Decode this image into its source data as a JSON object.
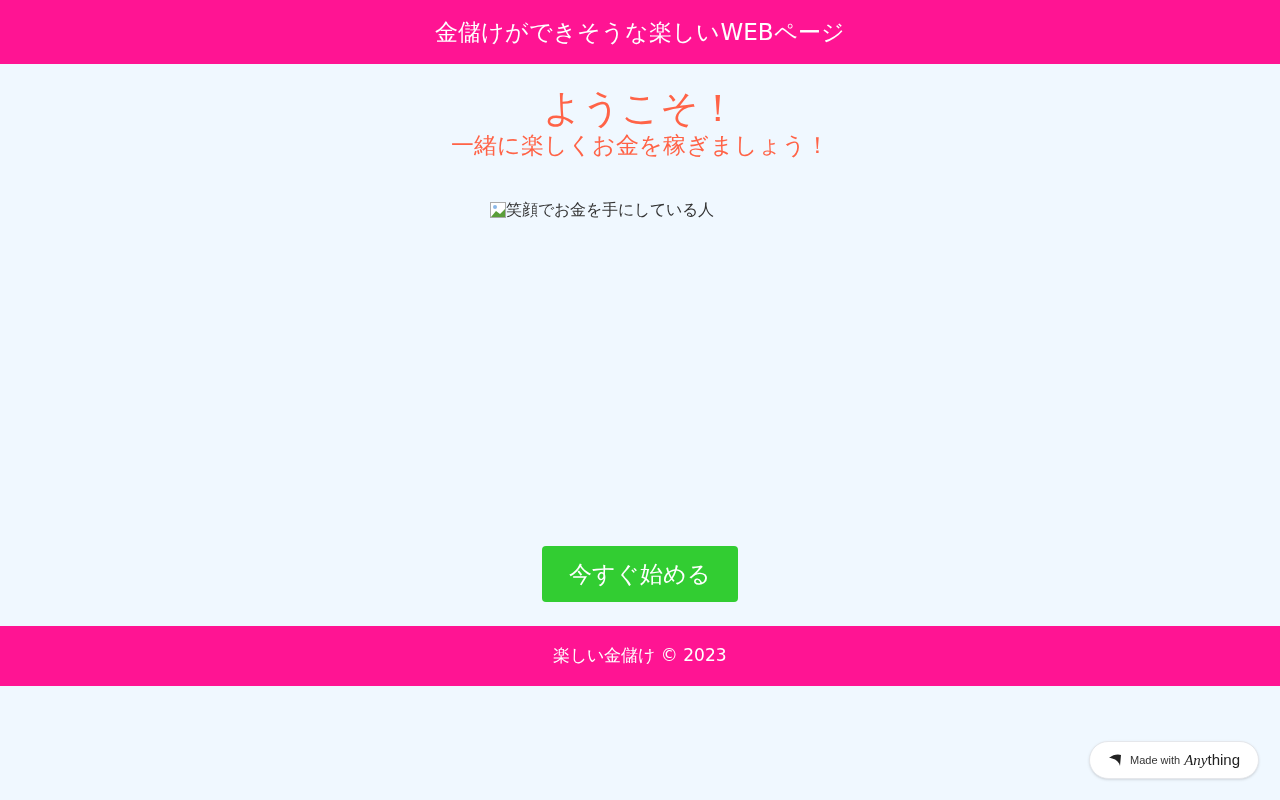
{
  "header": {
    "title": "金儲けができそうな楽しいWEBページ"
  },
  "hero": {
    "heading": "ようこそ！",
    "subheading": "一緒に楽しくお金を稼ぎましょう！",
    "image_alt": "笑顔でお金を手にしている人",
    "button": "今すぐ始める"
  },
  "footer": {
    "text": "楽しい金儲け © 2023"
  },
  "badge": {
    "label": "Made with",
    "brand_prefix": "Any",
    "brand_suffix": "thing"
  }
}
